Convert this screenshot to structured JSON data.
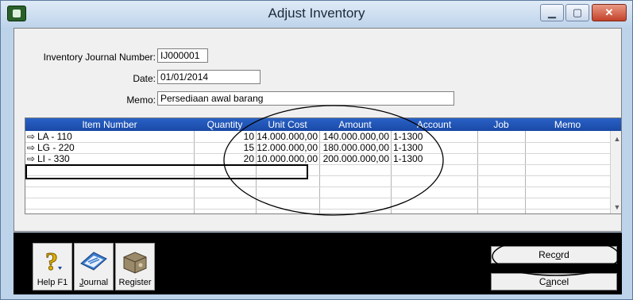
{
  "window": {
    "title": "Adjust Inventory"
  },
  "form": {
    "journal_number_label": "Inventory Journal Number:",
    "journal_number_value": "IJ000001",
    "date_label": "Date:",
    "date_value": "01/01/2014",
    "memo_label": "Memo:",
    "memo_value": "Persediaan awal barang"
  },
  "table": {
    "columns": [
      "Item Number",
      "Quantity",
      "Unit Cost",
      "Amount",
      "Account",
      "Job",
      "Memo"
    ],
    "rows": [
      {
        "item": "LA - 110",
        "quantity": "10",
        "unit_cost": "14.000.000,00",
        "amount": "140.000.000,00",
        "account": "1-1300"
      },
      {
        "item": "LG - 220",
        "quantity": "15",
        "unit_cost": "12.000.000,00",
        "amount": "180.000.000,00",
        "account": "1-1300"
      },
      {
        "item": "LI - 330",
        "quantity": "20",
        "unit_cost": "10.000.000,00",
        "amount": "200.000.000,00",
        "account": "1-1300"
      }
    ],
    "row_arrow": "⇨"
  },
  "toolbar": {
    "help_label": "Help F1",
    "journal_label": "Journal",
    "register_label": "Register"
  },
  "actions": {
    "record_label": "Record",
    "cancel_label": "Cancel"
  },
  "icons": {
    "help": "help-question-icon",
    "journal": "journal-book-icon",
    "register": "register-box-icon",
    "minimize": "minimize-icon",
    "maximize": "maximize-icon",
    "close": "close-icon"
  },
  "colors": {
    "header_blue": "#1f56b8",
    "window_frame": "#bcd3ea",
    "close_red": "#c4412a"
  }
}
